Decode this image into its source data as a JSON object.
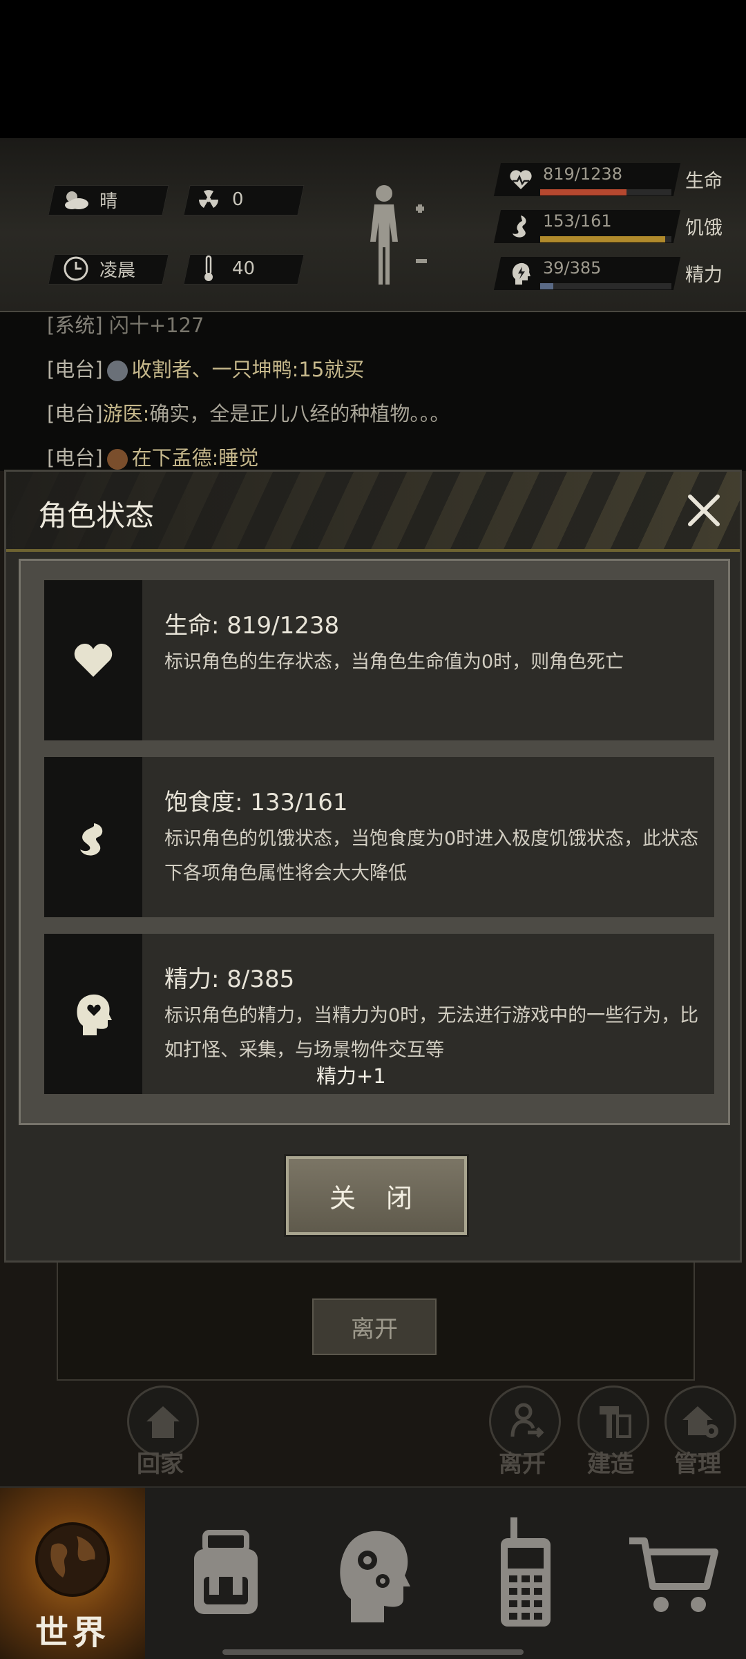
{
  "hud": {
    "weather": "晴",
    "radiation": "0",
    "time_of_day": "凌晨",
    "temperature": "40",
    "stats": [
      {
        "value": "819/1238",
        "label": "生命",
        "fill": 0.66,
        "color": "#b5482f",
        "icon": "heart-pulse-icon"
      },
      {
        "value": "153/161",
        "label": "饥饿",
        "fill": 0.95,
        "color": "#b08a2c",
        "icon": "stomach-icon"
      },
      {
        "value": "39/385",
        "label": "精力",
        "fill": 0.1,
        "color": "#5a6a86",
        "icon": "head-lightning-icon"
      }
    ]
  },
  "chat": {
    "lines": [
      {
        "tag": "[系统]",
        "name": "",
        "text": "闪十+127"
      },
      {
        "tag": "[电台]",
        "name": "",
        "text": "收割者、一只坤鸭:15就买"
      },
      {
        "tag": "[电台]",
        "name": "游医:",
        "text": "确实，全是正儿八经的种植物。。。"
      },
      {
        "tag": "[电台]",
        "name": "",
        "text": "在下孟德:睡觉"
      }
    ]
  },
  "scene": {
    "leave_button": "离开",
    "actions": [
      {
        "label": "回家",
        "icon": "house-icon"
      },
      {
        "label": "离开",
        "icon": "person-exit-icon"
      },
      {
        "label": "建造",
        "icon": "hammer-icon"
      },
      {
        "label": "管理",
        "icon": "house-gear-icon"
      }
    ]
  },
  "dialog": {
    "title": "角色状态",
    "cards": [
      {
        "title": "生命: 819/1238",
        "desc": "标识角色的生存状态，当角色生命值为0时，则角色死亡",
        "icon": "heart-icon"
      },
      {
        "title": "饱食度: 133/161",
        "desc": "标识角色的饥饿状态，当饱食度为0时进入极度饥饿状态，此状态下各项角色属性将会大大降低",
        "icon": "stomach-icon"
      },
      {
        "title": "精力: 8/385",
        "desc": "标识角色的精力，当精力为0时，无法进行游戏中的一些行为，比如打怪、采集，与场景物件交互等",
        "icon": "head-heart-icon"
      }
    ],
    "floating_text": "精力+1",
    "close_button": "关 闭"
  },
  "nav": {
    "world_label": "世界",
    "items": [
      "backpack-icon",
      "head-gears-icon",
      "walkie-talkie-icon",
      "shopping-cart-icon"
    ]
  }
}
